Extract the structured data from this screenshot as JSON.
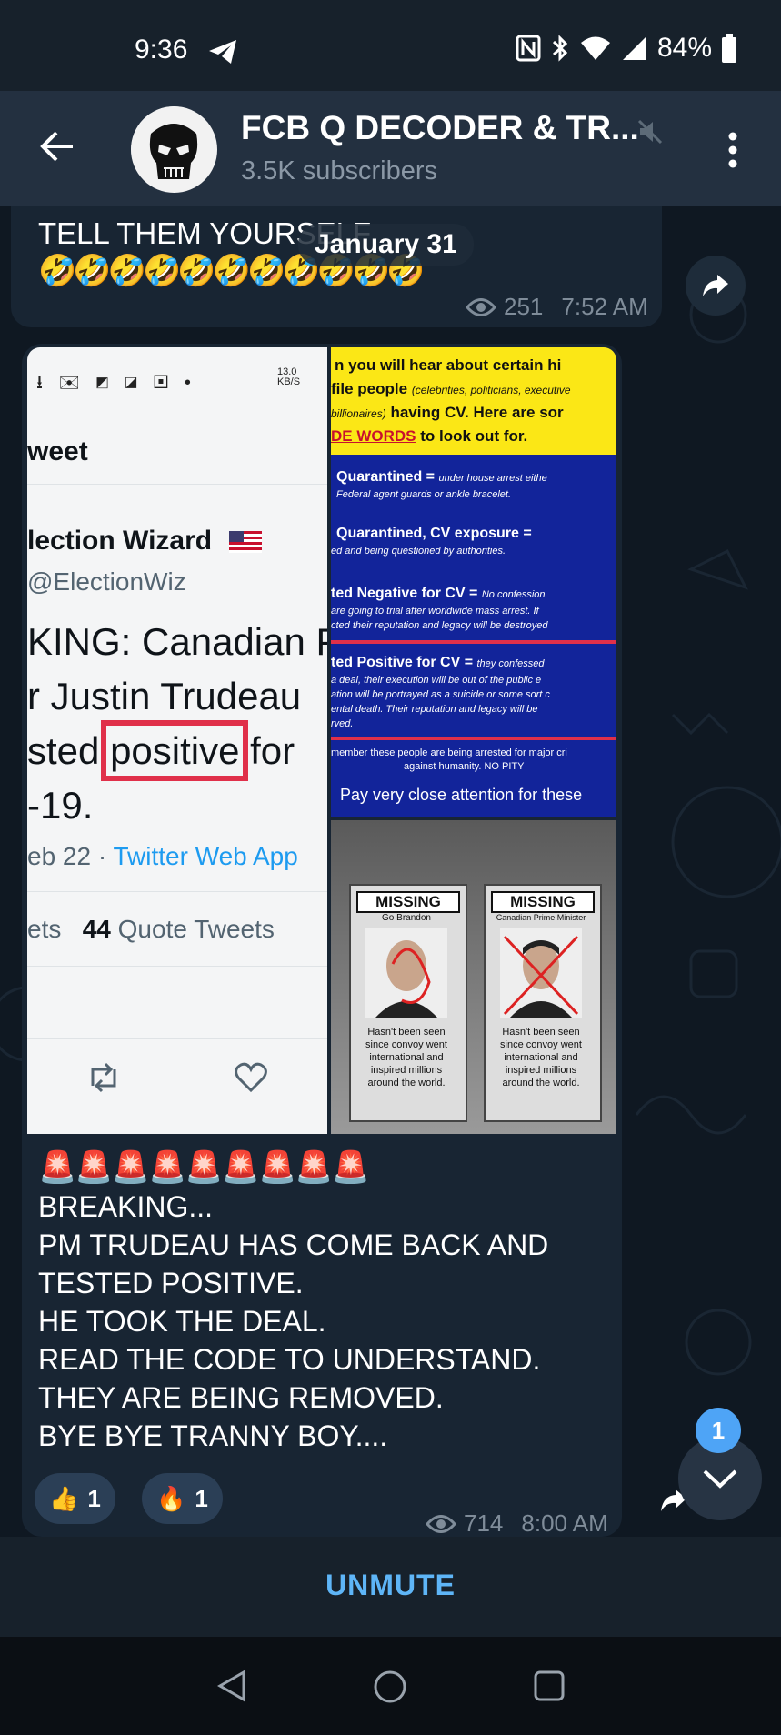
{
  "status_bar": {
    "time": "9:36",
    "battery": "84%"
  },
  "header": {
    "title": "FCB Q DECODER & TR...",
    "subtitle": "3.5K subscribers",
    "icons": [
      "back-arrow-icon",
      "muted-speaker-icon",
      "more-vert-icon"
    ]
  },
  "chat": {
    "date_pill": "January 31",
    "message1": {
      "text": "TELL THEM YOURSELF",
      "emoji": "🤣🤣🤣🤣🤣🤣🤣🤣🤣🤣🤣",
      "views": "251",
      "time": "7:52 AM"
    },
    "tweet": {
      "status_speed": "13.0\nKB/S",
      "heading": "weet",
      "name": "lection Wizard",
      "handle": "@ElectionWiz",
      "line1": "KING: Canadian P",
      "line2": "r Justin Trudeau",
      "line3a": "sted ",
      "line3b": "positive",
      "line3c": " for",
      "line4": "-19.",
      "date": "eb 22 · ",
      "source": "Twitter Web App",
      "stats_a": "ets",
      "quote_count": "44",
      "stats_b": "Quote Tweets"
    },
    "code_image": {
      "header1": "n you will hear about certain hi",
      "header2a": "file people",
      "header2b": "(celebrities, politicians, executive",
      "header3a": "billionaires)",
      "header3b": "having CV. Here are sor",
      "header4a": "DE WORDS",
      "header4b": "to look out for.",
      "items": [
        {
          "term": "Quarantined =",
          "desc1": "under house arrest eithe",
          "desc2": "Federal agent guards or ankle bracelet."
        },
        {
          "term": "Quarantined, CV exposure =",
          "desc1": "ed and being questioned by authorities.",
          "desc2": ""
        },
        {
          "term": "ted Negative for CV =",
          "desc1": "No confession",
          "desc2": "are going to trial after worldwide mass arrest. If",
          "desc3": "cted their reputation and legacy will be destroyed"
        },
        {
          "term": "ted Positive for CV =",
          "desc1": "they confessed",
          "desc2": "a deal, their execution will be out of the public e",
          "desc3": "ation will be portrayed as a suicide or some sort c",
          "desc4": "ental death. Their reputation and legacy will be",
          "desc5": "rved."
        }
      ],
      "footer1": "member these people are being arrested for major cri",
      "footer2": "against humanity. NO PITY",
      "footer3": "Pay very close attention for these"
    },
    "milk_image": {
      "left_title": "MISSING",
      "left_sub": "Go Brandon",
      "right_title": "MISSING",
      "right_sub": "Canadian Prime Minister",
      "caption1": "Hasn't been seen",
      "caption2": "since convoy went",
      "caption3": "international and",
      "caption4": "inspired millions",
      "caption5": "around the world."
    },
    "message2": {
      "sirens": "🚨🚨🚨🚨🚨🚨🚨🚨🚨",
      "lines": [
        "BREAKING...",
        "PM TRUDEAU HAS COME BACK AND",
        "TESTED POSITIVE.",
        "HE TOOK THE DEAL.",
        "READ THE CODE TO UNDERSTAND.",
        "THEY ARE BEING REMOVED.",
        "BYE BYE TRANNY BOY...."
      ],
      "reactions": [
        {
          "emoji": "👍",
          "count": "1"
        },
        {
          "emoji": "🔥",
          "count": "1"
        }
      ],
      "views": "714",
      "time": "8:00 AM"
    },
    "unread_count": "1"
  },
  "bottom": {
    "unmute_label": "UNMUTE"
  },
  "colors": {
    "accent": "#5eb5f7",
    "bubble": "#182533",
    "header": "#233040",
    "highlight_box": "#e0304a"
  }
}
